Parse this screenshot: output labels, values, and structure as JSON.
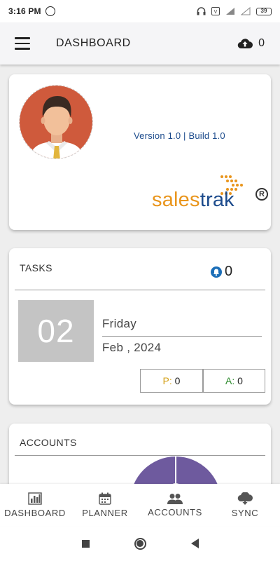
{
  "status_bar": {
    "time": "3:16 PM",
    "battery": "39"
  },
  "app_bar": {
    "title": "DASHBOARD",
    "pending_sync_count": "0"
  },
  "profile": {
    "version_text": "Version 1.0 | Build 1.0",
    "brand_part1": "sales",
    "brand_part2": "trak",
    "registered_mark": "R"
  },
  "tasks": {
    "title": "TASKS",
    "count": "0",
    "date": {
      "day_number": "02",
      "day_name": "Friday",
      "month_year": "Feb , 2024"
    },
    "p_label": "P:",
    "p_value": "0",
    "a_label": "A:",
    "a_value": "0"
  },
  "accounts": {
    "title": "ACCOUNTS"
  },
  "bottom_nav": [
    {
      "label": "DASHBOARD",
      "icon": "bar-chart-icon"
    },
    {
      "label": "PLANNER",
      "icon": "calendar-icon"
    },
    {
      "label": "ACCOUNTS",
      "icon": "people-icon"
    },
    {
      "label": "SYNC",
      "icon": "cloud-sync-icon"
    }
  ],
  "colors": {
    "accent_blue": "#1c4b8c",
    "brand_orange": "#e9951c",
    "pie_purple": "#6e5a9e",
    "p_yellow": "#d4a017",
    "a_green": "#2e8b2e"
  }
}
